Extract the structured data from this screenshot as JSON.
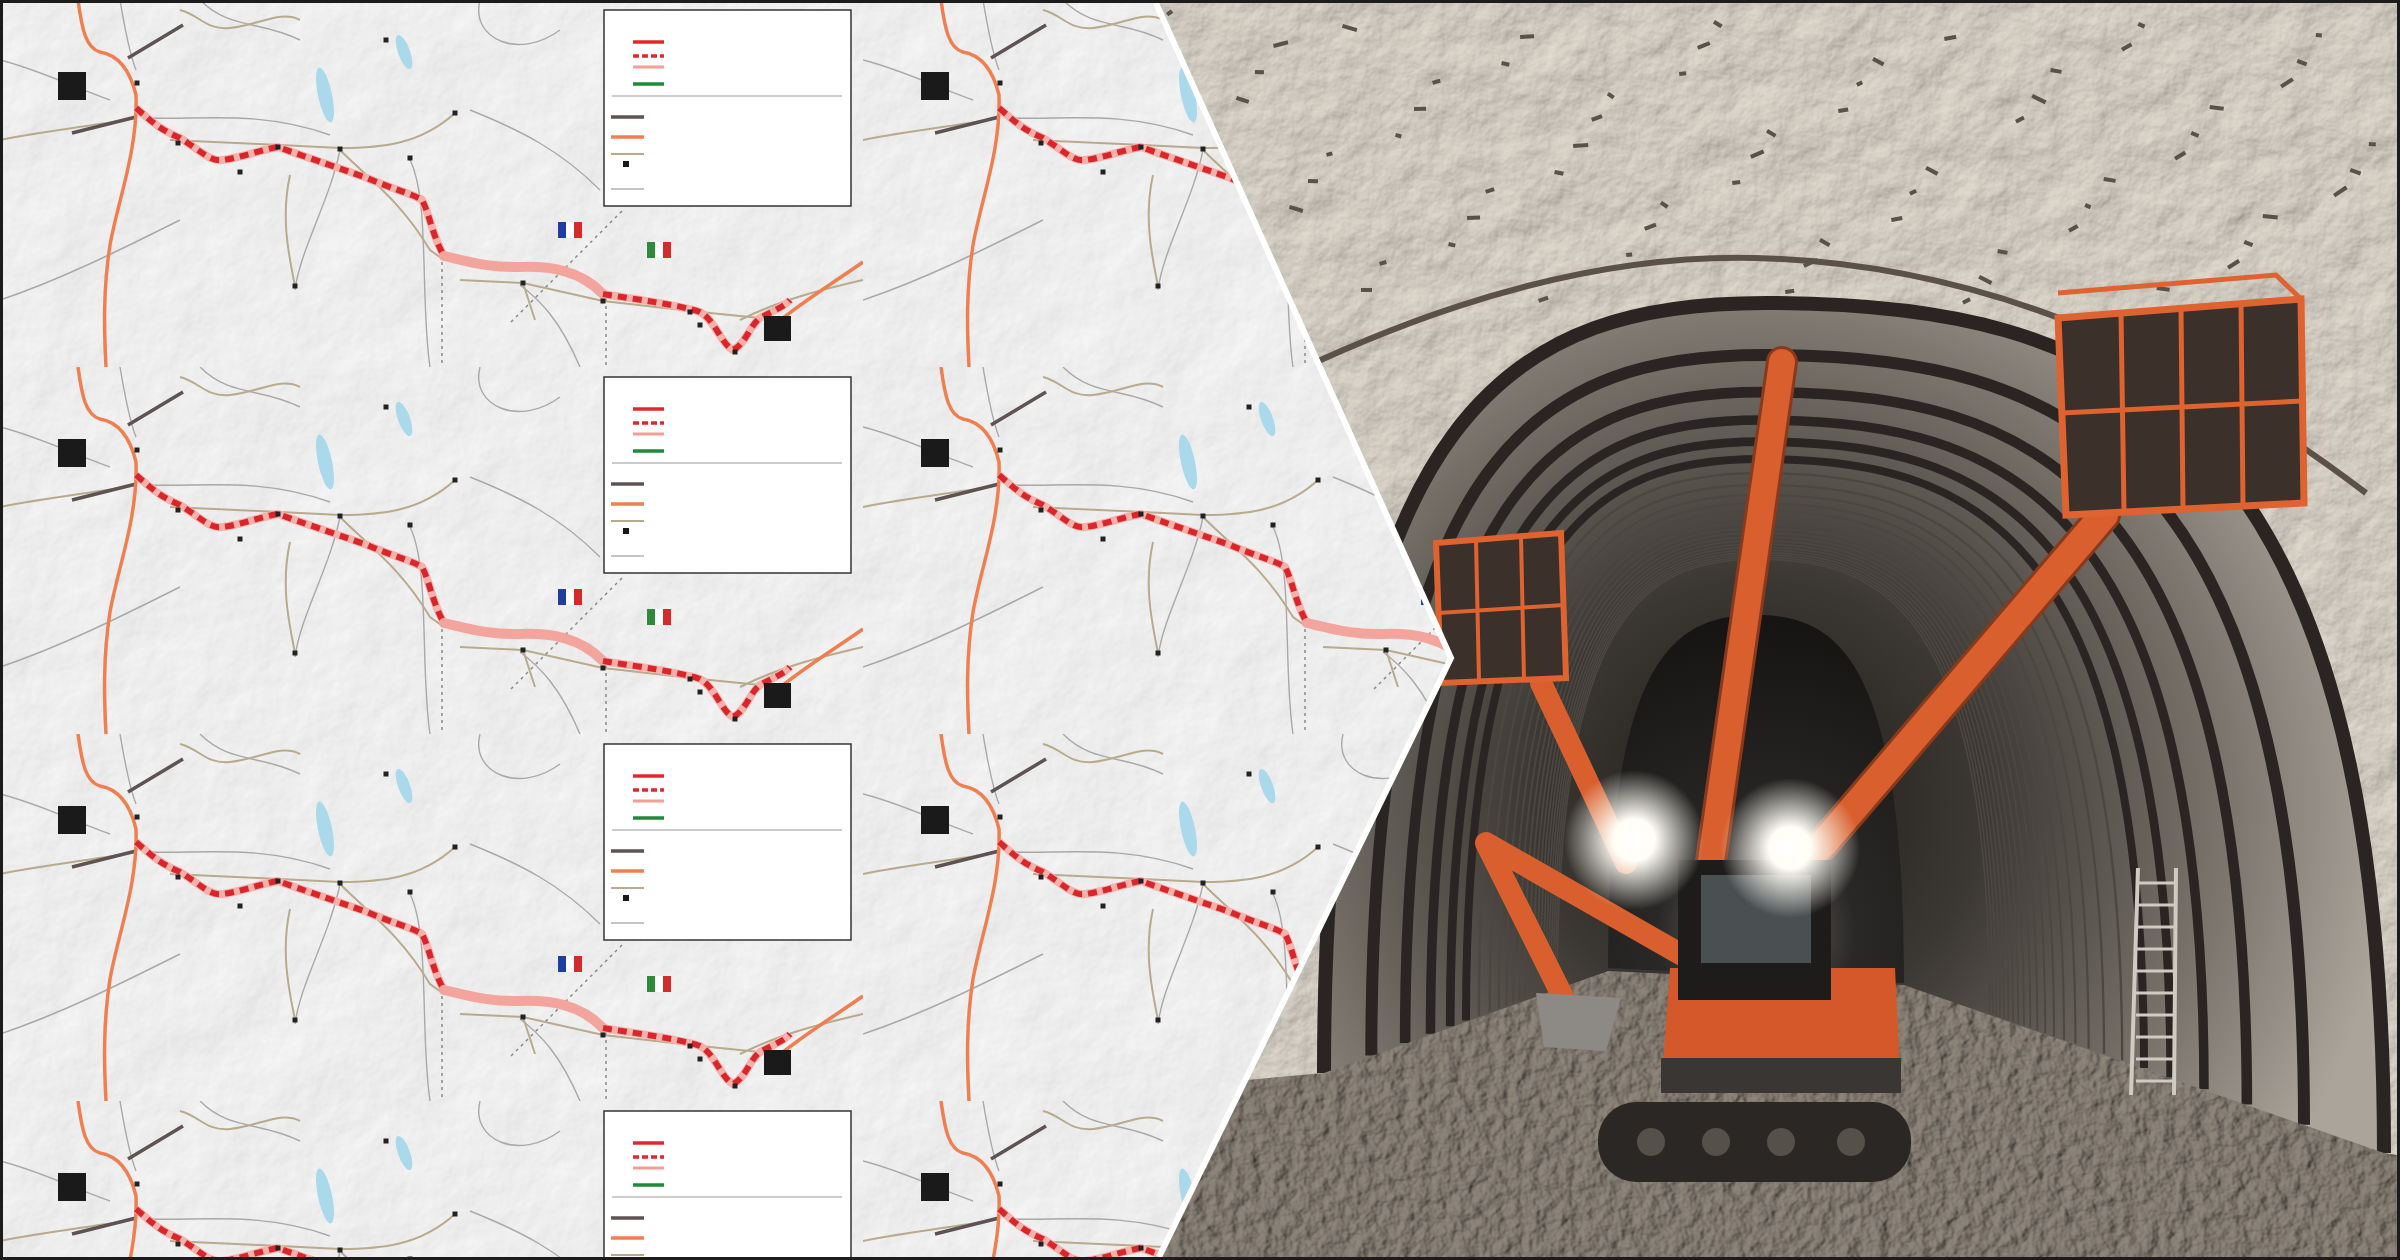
{
  "collage": [
    {
      "kind": "map"
    },
    {
      "kind": "photo"
    }
  ]
}
